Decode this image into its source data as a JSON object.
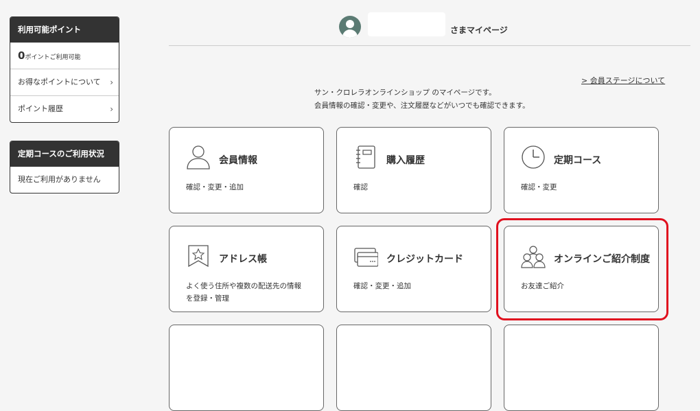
{
  "sidebar": {
    "points": {
      "header": "利用可能ポイント",
      "value": "0",
      "unit": "ポイントご利用可能",
      "about_label": "お得なポイントについて",
      "history_label": "ポイント履歴"
    },
    "course": {
      "header": "定期コースのご利用状況",
      "status": "現在ご利用がありません"
    }
  },
  "header": {
    "greeting": "さまマイページ"
  },
  "stage_link": "> 会員ステージについて",
  "intro": {
    "line1": "サン・クロレラオンラインショップ のマイページです。",
    "line2": "会員情報の確認・変更や、注文履歴などがいつでも確認できます。"
  },
  "cards": [
    {
      "title": "会員情報",
      "sub1": "確認・変更・追加",
      "sub2": "",
      "icon": "person-icon"
    },
    {
      "title": "購入履歴",
      "sub1": "確認",
      "sub2": "",
      "icon": "notebook-icon"
    },
    {
      "title": "定期コース",
      "sub1": "確認・変更",
      "sub2": "",
      "icon": "clock-icon"
    },
    {
      "title": "アドレス帳",
      "sub1": "よく使う住所や複数の配送先の情報",
      "sub2": "を登録・管理",
      "icon": "bookmark-star-icon"
    },
    {
      "title": "クレジットカード",
      "sub1": "確認・変更・追加",
      "sub2": "",
      "icon": "credit-card-icon"
    },
    {
      "title": "オンラインご紹介制度",
      "sub1": "お友達ご紹介",
      "sub2": "",
      "icon": "group-icon"
    }
  ],
  "colors": {
    "dark": "#333333",
    "accent_avatar": "#5b7b73",
    "highlight_border": "#e0101e",
    "background": "#f5f5f5"
  }
}
